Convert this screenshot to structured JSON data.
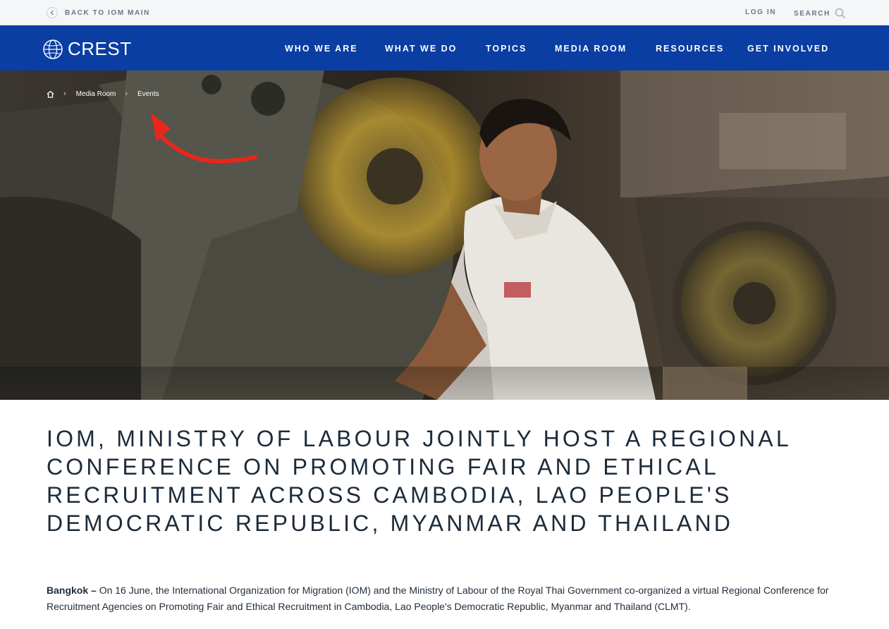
{
  "utility": {
    "back_label": "BACK TO IOM MAIN",
    "login_label": "LOG IN",
    "search_label": "SEARCH"
  },
  "nav": {
    "logo_text": "CREST",
    "items": [
      "WHO WE ARE",
      "WHAT WE DO",
      "TOPICS",
      "MEDIA ROOM",
      "RESOURCES",
      "GET INVOLVED"
    ]
  },
  "breadcrumb": {
    "items": [
      "Media Room",
      "Events"
    ]
  },
  "article": {
    "title": "IOM, MINISTRY OF LABOUR JOINTLY HOST A REGIONAL CONFERENCE ON PROMOTING FAIR AND ETHICAL RECRUITMENT ACROSS CAMBODIA, LAO PEOPLE'S DEMOCRATIC REPUBLIC, MYANMAR AND THAILAND",
    "dateline": "Bangkok –",
    "body": "On 16 June, the International Organization for Migration (IOM) and the Ministry of Labour of the Royal Thai Government co-organized a virtual Regional Conference for Recruitment Agencies on Promoting Fair and Ethical Recruitment in Cambodia, Lao People's Democratic Republic, Myanmar and Thailand (CLMT)."
  },
  "colors": {
    "nav_blue": "#0a3ea3",
    "annotation_red": "#e8271c"
  },
  "icons": [
    "back-chevron-icon",
    "search-icon",
    "crest-globe-icon",
    "home-icon",
    "annotation-arrow-icon"
  ]
}
